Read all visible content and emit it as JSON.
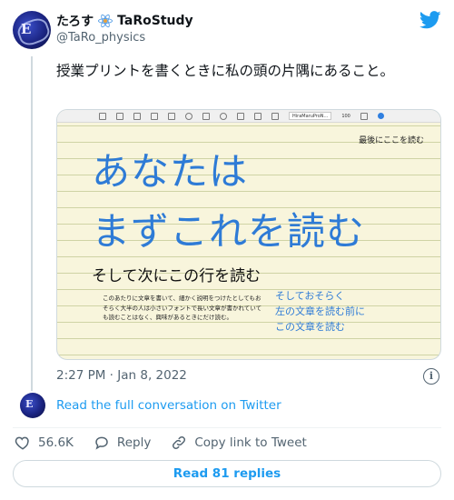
{
  "author": {
    "display_name": "たろす",
    "study_name": "TaRoStudy",
    "handle": "@TaRo_physics"
  },
  "tweet": {
    "text": "授業プリントを書くときに私の頭の片隅にあること。",
    "timestamp": "2:27 PM · Jan 8, 2022"
  },
  "media": {
    "toolbar_font": "HiraMaruProN...",
    "toolbar_size": "100",
    "read_last": "最後にここを読む",
    "headline_1": "あなたは",
    "headline_2": "まずこれを読む",
    "next_line": "そして次にこの行を読む",
    "small_paragraph": "このあたりに文章を書いて、細かく説明をつけたとしてもおそらく大半の人は小さいフォントで長い文章が書かれていても読むことはなく、興味があるときにだけ読む。",
    "blue_lines": [
      "そしておそらく",
      "左の文章を読む前に",
      "この文章を読む"
    ]
  },
  "conversation_link": "Read the full conversation on Twitter",
  "actions": {
    "likes": "56.6K",
    "reply": "Reply",
    "copy_link": "Copy link to Tweet"
  },
  "read_replies": "Read 81 replies",
  "colors": {
    "twitter_blue": "#1d9bf0",
    "handwriting_blue": "#2e7bd6",
    "paper": "#f8f5dc"
  }
}
